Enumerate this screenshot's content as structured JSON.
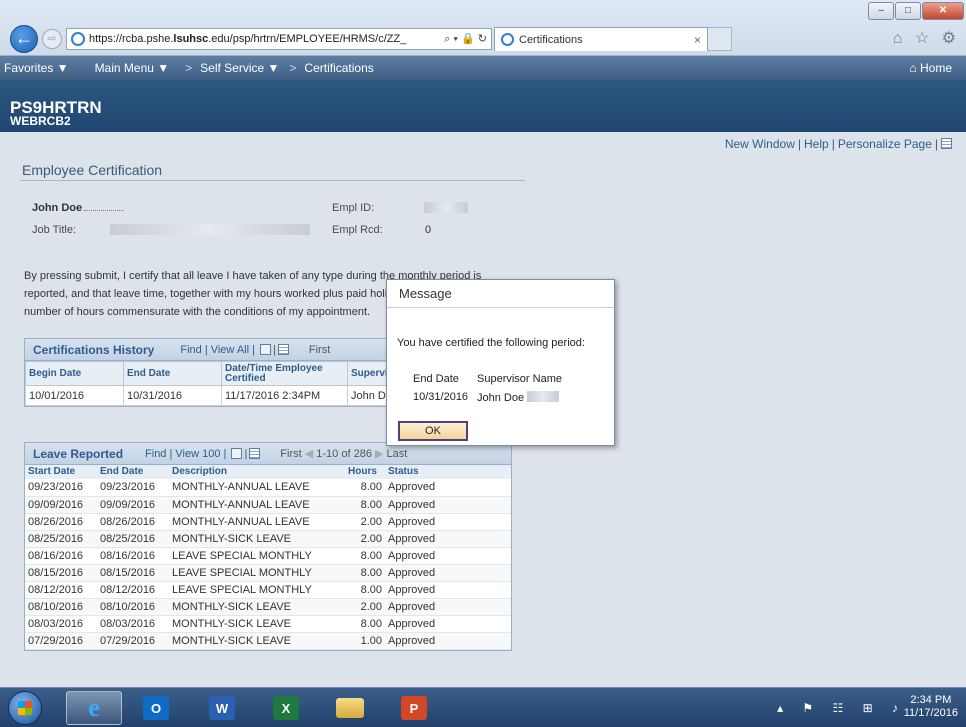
{
  "browser": {
    "url_prefix": "https://rcba.pshe.",
    "url_host_bold": "lsuhsc",
    "url_rest": ".edu/psp/hrtrn/EMPLOYEE/HRMS/c/ZZ_",
    "addr_tools": "⌕ ▾ 🔒 ↻",
    "tab_label": "Certifications",
    "tab_close": "×",
    "window_buttons": [
      "–",
      "□",
      "✕"
    ],
    "back_glyph": "←",
    "forward_glyph": "⇨",
    "chrome_icons": "⌂ ☆ ⚙"
  },
  "psnav": {
    "favorites": "Favorites ▼",
    "main_menu": "Main Menu ▼",
    "sep": ">",
    "self_service": "Self Service ▼",
    "certifications": "Certifications",
    "home": "⌂ Home"
  },
  "banner": {
    "db": "PS9HRTRN",
    "server": "WEBRCB2"
  },
  "toplinks": {
    "new_window": "New Window",
    "help": "Help",
    "personalize": "Personalize Page",
    "pipe": "|"
  },
  "page": {
    "title": "Employee Certification",
    "employee_name": "John Doe",
    "job_title_label": "Job Title:",
    "empl_id_label": "Empl ID:",
    "empl_rcd_label": "Empl Rcd:",
    "empl_rcd_value": "0",
    "certify_text": "By pressing submit, I certify that all leave I have taken of any type during the monthly period is reported, and that leave time, together with my hours worked plus paid holidays, equals the required number of hours commensurate with the conditions of my appointment."
  },
  "cert_history": {
    "title": "Certifications History",
    "tools": "Find | View All |",
    "nav": "First",
    "columns": [
      "Begin Date",
      "End Date",
      "Date/Time Employee Certified",
      "Supervisor"
    ],
    "rows": [
      [
        "10/01/2016",
        "10/31/2016",
        "11/17/2016  2:34PM",
        "John D"
      ]
    ]
  },
  "leave": {
    "title": "Leave Reported",
    "tools": "Find | View 100 |",
    "nav_first": "First",
    "nav_range": "1-10 of 286",
    "nav_last": "Last",
    "columns": [
      "Start Date",
      "End Date",
      "Description",
      "Hours",
      "Status"
    ],
    "rows": [
      [
        "09/23/2016",
        "09/23/2016",
        "MONTHLY-ANNUAL LEAVE",
        "8.00",
        "Approved"
      ],
      [
        "09/09/2016",
        "09/09/2016",
        "MONTHLY-ANNUAL LEAVE",
        "8.00",
        "Approved"
      ],
      [
        "08/26/2016",
        "08/26/2016",
        "MONTHLY-ANNUAL LEAVE",
        "2.00",
        "Approved"
      ],
      [
        "08/25/2016",
        "08/25/2016",
        "MONTHLY-SICK LEAVE",
        "2.00",
        "Approved"
      ],
      [
        "08/16/2016",
        "08/16/2016",
        "LEAVE SPECIAL MONTHLY",
        "8.00",
        "Approved"
      ],
      [
        "08/15/2016",
        "08/15/2016",
        "LEAVE SPECIAL MONTHLY",
        "8.00",
        "Approved"
      ],
      [
        "08/12/2016",
        "08/12/2016",
        "LEAVE SPECIAL MONTHLY",
        "8.00",
        "Approved"
      ],
      [
        "08/10/2016",
        "08/10/2016",
        "MONTHLY-SICK LEAVE",
        "2.00",
        "Approved"
      ],
      [
        "08/03/2016",
        "08/03/2016",
        "MONTHLY-SICK LEAVE",
        "8.00",
        "Approved"
      ],
      [
        "07/29/2016",
        "07/29/2016",
        "MONTHLY-SICK LEAVE",
        "1.00",
        "Approved"
      ]
    ]
  },
  "modal": {
    "title": "Message",
    "message": "You have certified the following period:",
    "col1_header": "End Date",
    "col2_header": "Supervisor Name",
    "col1_value": "10/31/2016",
    "col2_value": "John Doe",
    "ok_label": "OK"
  },
  "taskbar": {
    "outlook": "O",
    "word": "W",
    "excel": "X",
    "powerpoint": "P",
    "tray": "▴ ⚑ ☷ ⊞ ♪",
    "time": "2:34 PM",
    "date": "11/17/2016"
  },
  "colors": {
    "ps_blue": "#2e5d8f",
    "ok_border": "#5a3b7d"
  }
}
